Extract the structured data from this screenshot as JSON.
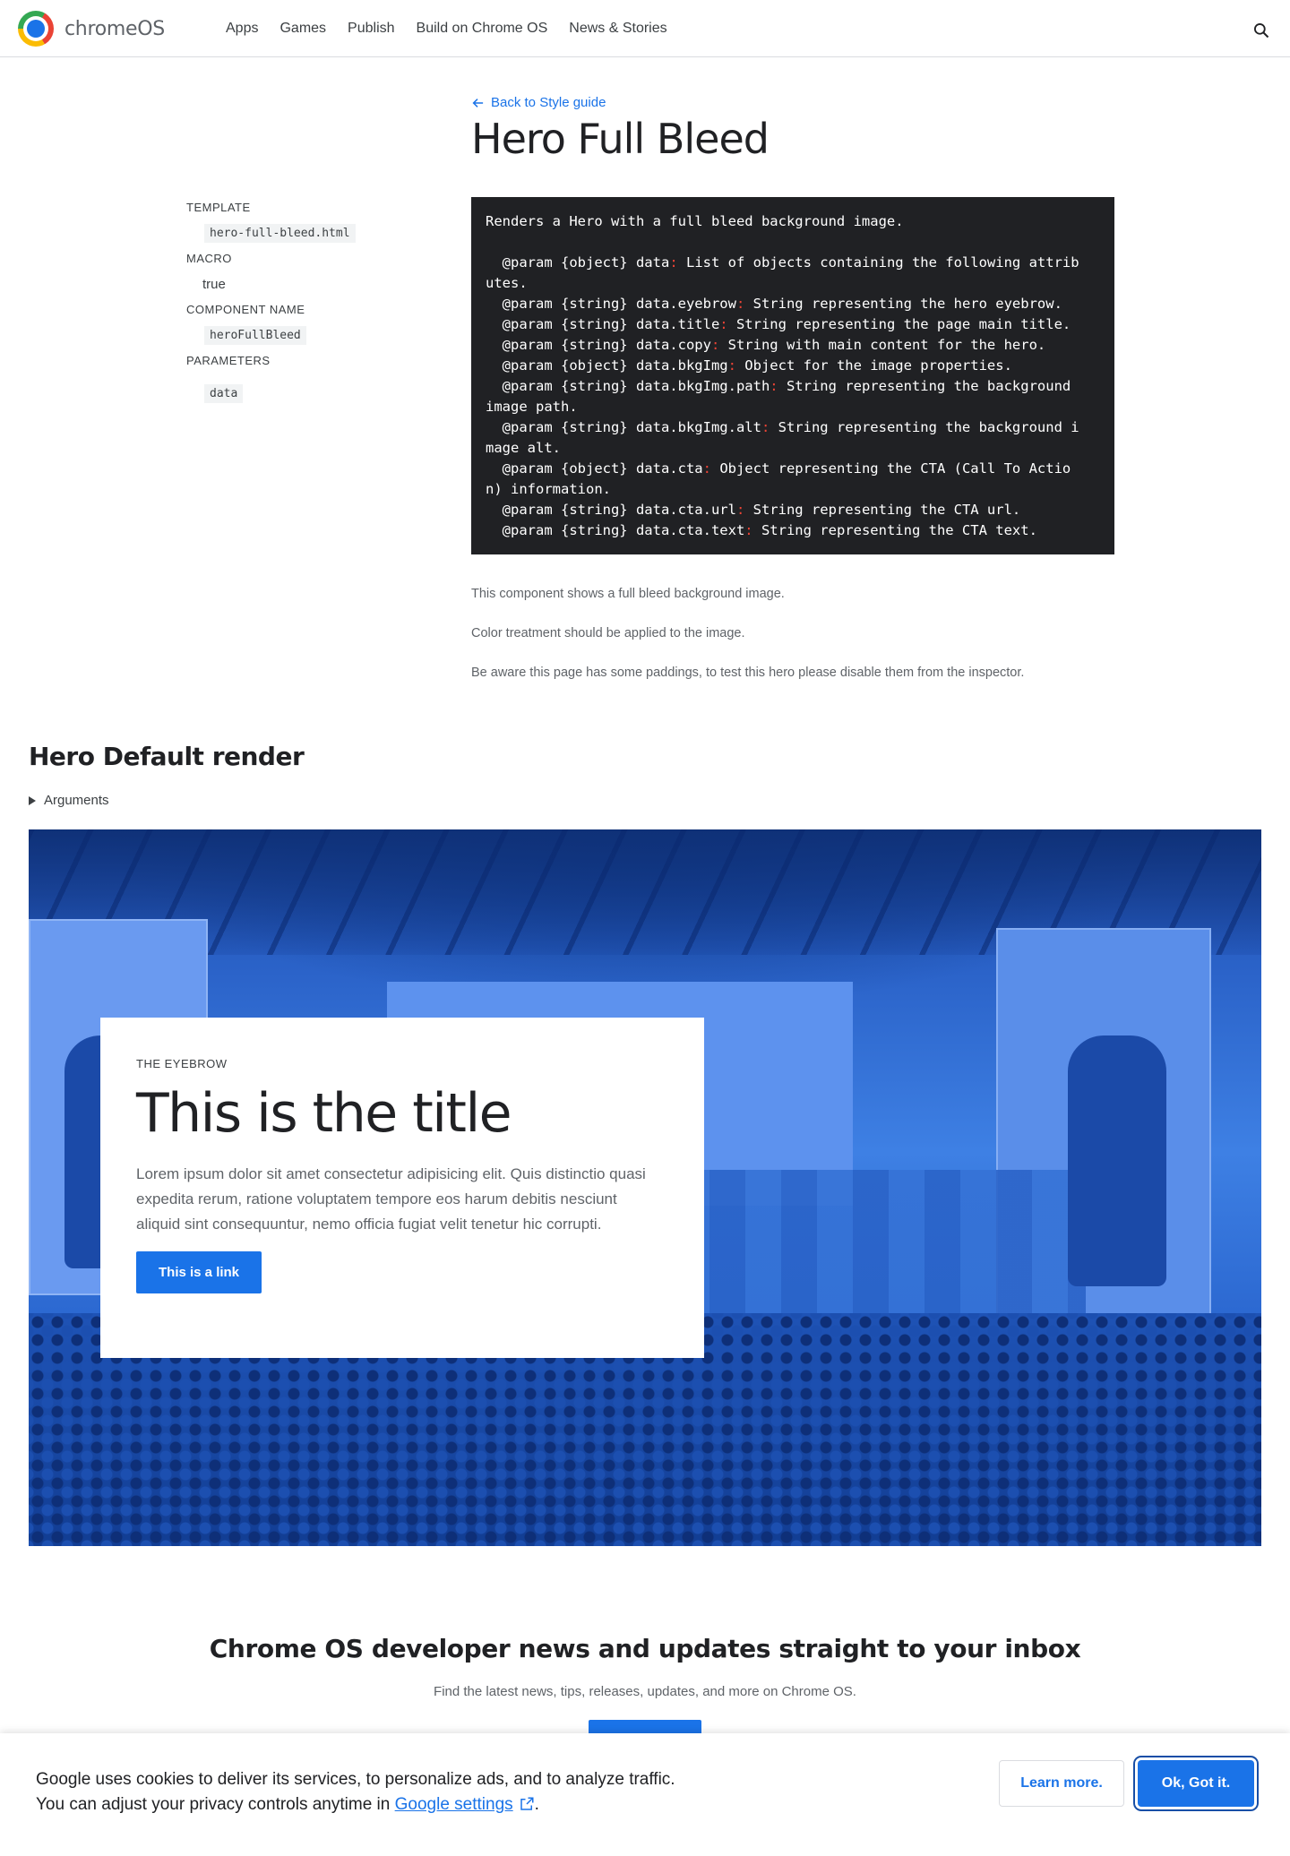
{
  "header": {
    "brand": "chromeOS",
    "nav": [
      "Apps",
      "Games",
      "Publish",
      "Build on Chrome OS",
      "News & Stories"
    ]
  },
  "meta": {
    "template_label": "TEMPLATE",
    "template_value": "hero-full-bleed.html",
    "macro_label": "MACRO",
    "macro_value": "true",
    "component_label": "COMPONENT NAME",
    "component_value": "heroFullBleed",
    "parameters_label": "PARAMETERS",
    "parameters_value": "data"
  },
  "page": {
    "back_link": "Back to Style guide",
    "title": "Hero Full Bleed"
  },
  "code_lines": [
    "Renders a Hero with a full bleed background image.",
    "",
    "  @param {object} data: List of objects containing the following attrib",
    "utes.",
    "  @param {string} data.eyebrow: String representing the hero eyebrow.",
    "  @param {string} data.title: String representing the page main title.",
    "  @param {string} data.copy: String with main content for the hero.",
    "  @param {object} data.bkgImg: Object for the image properties.",
    "  @param {string} data.bkgImg.path: String representing the background",
    "image path.",
    "  @param {string} data.bkgImg.alt: String representing the background i",
    "mage alt.",
    "  @param {object} data.cta: Object representing the CTA (Call To Actio",
    "n) information.",
    "  @param {string} data.cta.url: String representing the CTA url.",
    "  @param {string} data.cta.text: String representing the CTA text."
  ],
  "descriptions": [
    "This component shows a full bleed background image.",
    "Color treatment should be applied to the image.",
    "Be aware this page has some paddings, to test this hero please disable them from the inspector."
  ],
  "section": {
    "title": "Hero Default render",
    "arguments": "Arguments"
  },
  "hero": {
    "eyebrow": "THE EYEBROW",
    "title": "This is the title",
    "copy": "Lorem ipsum dolor sit amet consectetur adipisicing elit. Quis distinctio quasi expedita rerum, ratione voluptatem tempore eos harum debitis nesciunt aliquid sint consequuntur, nemo officia fugiat velit tenetur hic corrupti.",
    "cta": "This is a link"
  },
  "newsletter": {
    "title": "Chrome OS developer news and updates straight to your inbox",
    "subtitle": "Find the latest news, tips, releases, updates, and more on Chrome OS."
  },
  "cookie": {
    "line1": "Google uses cookies to deliver its services, to personalize ads, and to analyze traffic.",
    "line2_prefix": "You can adjust your privacy controls anytime in ",
    "link": "Google settings",
    "line2_suffix": ".",
    "learn_more": "Learn more.",
    "ok": "Ok, Got it."
  },
  "colors": {
    "accent": "#1a73e8",
    "code_bg": "#202124",
    "hero_tint": "#2f6fd6"
  }
}
